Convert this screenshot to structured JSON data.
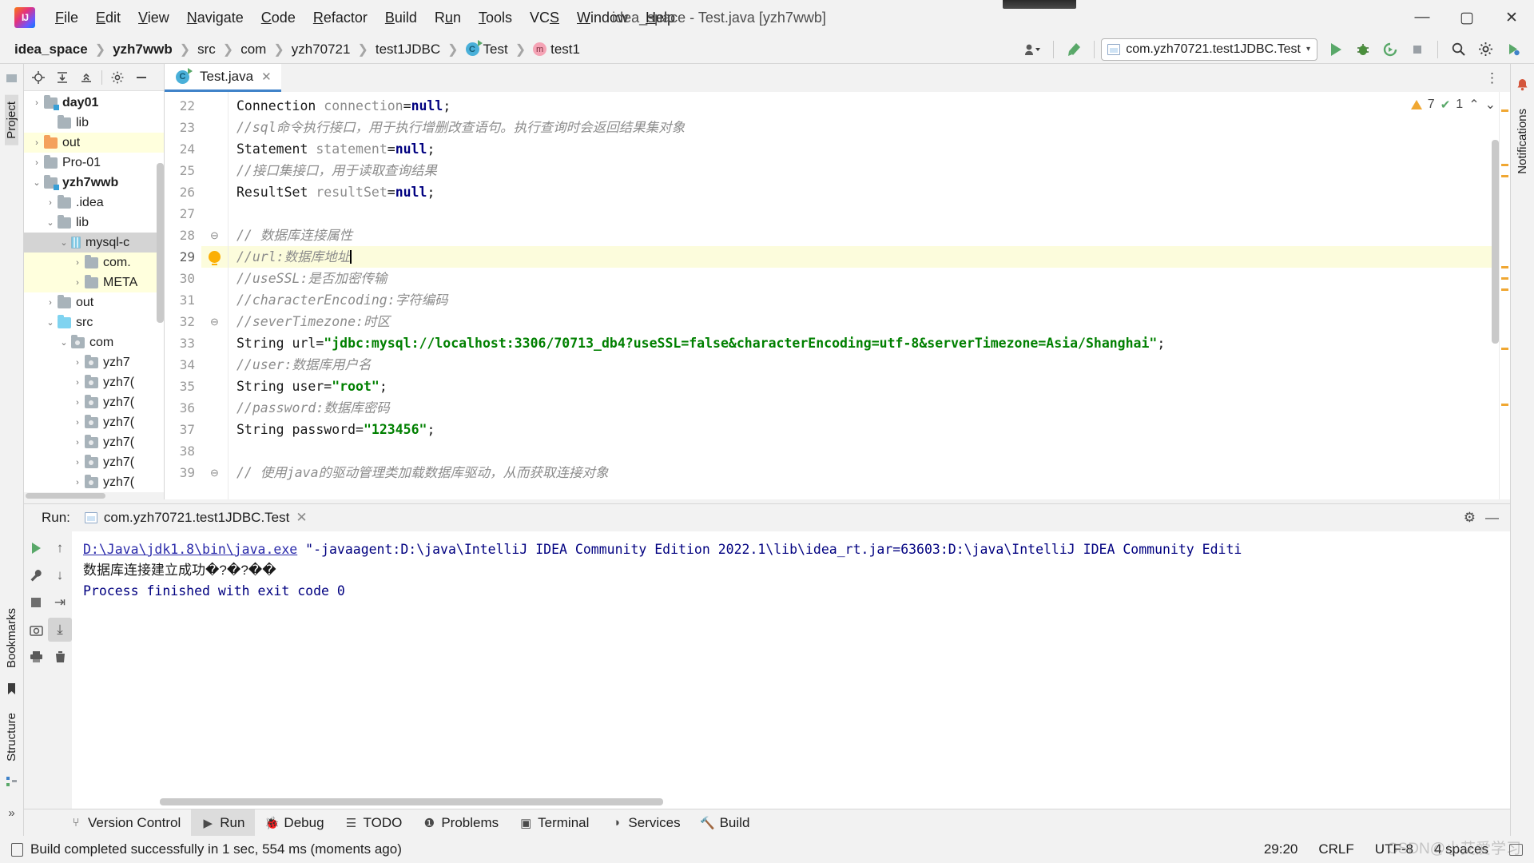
{
  "window": {
    "title": "idea_space - Test.java [yzh7wwb]",
    "logo_text": "IJ",
    "minimize": "—",
    "maximize": "▢",
    "close": "✕"
  },
  "menu": [
    {
      "pre": "",
      "mn": "F",
      "post": "ile"
    },
    {
      "pre": "",
      "mn": "E",
      "post": "dit"
    },
    {
      "pre": "",
      "mn": "V",
      "post": "iew"
    },
    {
      "pre": "",
      "mn": "N",
      "post": "avigate"
    },
    {
      "pre": "",
      "mn": "C",
      "post": "ode"
    },
    {
      "pre": "",
      "mn": "R",
      "post": "efactor"
    },
    {
      "pre": "",
      "mn": "B",
      "post": "uild"
    },
    {
      "pre": "R",
      "mn": "u",
      "post": "n"
    },
    {
      "pre": "",
      "mn": "T",
      "post": "ools"
    },
    {
      "pre": "VC",
      "mn": "S",
      "post": ""
    },
    {
      "pre": "",
      "mn": "W",
      "post": "indow"
    },
    {
      "pre": "",
      "mn": "H",
      "post": "elp"
    }
  ],
  "breadcrumbs": [
    {
      "label": "idea_space",
      "bold": true,
      "icon": ""
    },
    {
      "label": "yzh7wwb",
      "bold": true,
      "icon": ""
    },
    {
      "label": "src",
      "bold": false,
      "icon": ""
    },
    {
      "label": "com",
      "bold": false,
      "icon": ""
    },
    {
      "label": "yzh70721",
      "bold": false,
      "icon": ""
    },
    {
      "label": "test1JDBC",
      "bold": false,
      "icon": ""
    },
    {
      "label": "Test",
      "bold": false,
      "icon": "class-icon"
    },
    {
      "label": "test1",
      "bold": false,
      "icon": "method-icon"
    }
  ],
  "navbar": {
    "separator": "❯",
    "account_icon": "account-icon",
    "hammer_icon": "build-hammer-icon",
    "run_config": "com.yzh70721.test1JDBC.Test",
    "run_config_caret": "▾",
    "run_icon": "run-icon",
    "debug_icon": "debug-icon",
    "run_coverage_icon": "run-with-coverage-icon",
    "stop_icon": "stop-icon",
    "search_icon": "🔍",
    "settings_icon": "⚙",
    "updates_icon": "updates-icon"
  },
  "left_rail": {
    "project_label": "Project",
    "bookmarks_label": "Bookmarks",
    "structure_label": "Structure",
    "more_label": "»"
  },
  "right_rail": {
    "notifications_label": "Notifications"
  },
  "project_panel": {
    "toolbar": [
      "locate-icon",
      "expand-all-icon",
      "collapse-all-icon",
      "gear-icon",
      "hide-icon"
    ],
    "tree": [
      {
        "label": "day01",
        "indent": 1,
        "twisty": "›",
        "icon": "folder-module",
        "bold": true,
        "state": "none",
        "partial": true
      },
      {
        "label": "lib",
        "indent": 2,
        "twisty": "",
        "icon": "folder",
        "bold": false,
        "state": "none"
      },
      {
        "label": "out",
        "indent": 1,
        "twisty": "›",
        "icon": "folder-orange",
        "bold": false,
        "state": "yellow"
      },
      {
        "label": "Pro-01",
        "indent": 1,
        "twisty": "›",
        "icon": "folder",
        "bold": false,
        "state": "none"
      },
      {
        "label": "yzh7wwb",
        "indent": 1,
        "twisty": "⌄",
        "icon": "folder-module",
        "bold": true,
        "state": "none"
      },
      {
        "label": ".idea",
        "indent": 2,
        "twisty": "›",
        "icon": "folder",
        "bold": false,
        "state": "none"
      },
      {
        "label": "lib",
        "indent": 2,
        "twisty": "⌄",
        "icon": "folder",
        "bold": false,
        "state": "none"
      },
      {
        "label": "mysql-c",
        "indent": 3,
        "twisty": "⌄",
        "icon": "jar",
        "bold": false,
        "state": "grey"
      },
      {
        "label": "com.",
        "indent": 4,
        "twisty": "›",
        "icon": "folder",
        "bold": false,
        "state": "yellow"
      },
      {
        "label": "META",
        "indent": 4,
        "twisty": "›",
        "icon": "folder",
        "bold": false,
        "state": "yellow"
      },
      {
        "label": "out",
        "indent": 2,
        "twisty": "›",
        "icon": "folder",
        "bold": false,
        "state": "none"
      },
      {
        "label": "src",
        "indent": 2,
        "twisty": "⌄",
        "icon": "folder-blue",
        "bold": false,
        "state": "none"
      },
      {
        "label": "com",
        "indent": 3,
        "twisty": "⌄",
        "icon": "folder-pkg",
        "bold": false,
        "state": "none"
      },
      {
        "label": "yzh7",
        "indent": 4,
        "twisty": "›",
        "icon": "folder-pkg",
        "bold": false,
        "state": "none"
      },
      {
        "label": "yzh7(",
        "indent": 4,
        "twisty": "›",
        "icon": "folder-pkg",
        "bold": false,
        "state": "none"
      },
      {
        "label": "yzh7(",
        "indent": 4,
        "twisty": "›",
        "icon": "folder-pkg",
        "bold": false,
        "state": "none"
      },
      {
        "label": "yzh7(",
        "indent": 4,
        "twisty": "›",
        "icon": "folder-pkg",
        "bold": false,
        "state": "none"
      },
      {
        "label": "yzh7(",
        "indent": 4,
        "twisty": "›",
        "icon": "folder-pkg",
        "bold": false,
        "state": "none"
      },
      {
        "label": "yzh7(",
        "indent": 4,
        "twisty": "›",
        "icon": "folder-pkg",
        "bold": false,
        "state": "none"
      },
      {
        "label": "yzh7(",
        "indent": 4,
        "twisty": "›",
        "icon": "folder-pkg",
        "bold": false,
        "state": "none"
      }
    ]
  },
  "editor": {
    "tab": {
      "label": "Test.java",
      "icon": "java-class-icon",
      "close": "✕"
    },
    "tab_options_icon": "⋮",
    "inspection": {
      "warning_count": "7",
      "check_count": "1",
      "up": "⌃",
      "down": "⌄"
    },
    "first_line": 22,
    "lines": [
      {
        "n": 22,
        "marker": "",
        "segs": [
          {
            "t": "Connection ",
            "c": "type"
          },
          {
            "t": "connection",
            "c": "var"
          },
          {
            "t": "=",
            "c": "type"
          },
          {
            "t": "null",
            "c": "kw"
          },
          {
            "t": ";",
            "c": "type"
          }
        ]
      },
      {
        "n": 23,
        "marker": "",
        "segs": [
          {
            "t": "//sql命令执行接口，用于执行增删改查语句。执行查询时会返回结果集对象",
            "c": "cmt"
          }
        ]
      },
      {
        "n": 24,
        "marker": "",
        "segs": [
          {
            "t": "Statement ",
            "c": "type"
          },
          {
            "t": "statement",
            "c": "var"
          },
          {
            "t": "=",
            "c": "type"
          },
          {
            "t": "null",
            "c": "kw"
          },
          {
            "t": ";",
            "c": "type"
          }
        ]
      },
      {
        "n": 25,
        "marker": "",
        "segs": [
          {
            "t": "//接口集接口，用于读取查询结果",
            "c": "cmt"
          }
        ]
      },
      {
        "n": 26,
        "marker": "",
        "segs": [
          {
            "t": "ResultSet ",
            "c": "type"
          },
          {
            "t": "resultSet",
            "c": "var"
          },
          {
            "t": "=",
            "c": "type"
          },
          {
            "t": "null",
            "c": "kw"
          },
          {
            "t": ";",
            "c": "type"
          }
        ]
      },
      {
        "n": 27,
        "marker": "",
        "segs": []
      },
      {
        "n": 28,
        "marker": "fold",
        "segs": [
          {
            "t": "// 数据库连接属性",
            "c": "cmt"
          }
        ]
      },
      {
        "n": 29,
        "marker": "bulb",
        "highlight": true,
        "caret": true,
        "segs": [
          {
            "t": "//url:数据库地址",
            "c": "cmt"
          }
        ]
      },
      {
        "n": 30,
        "marker": "",
        "segs": [
          {
            "t": "//useSSL:是否加密传输",
            "c": "cmt"
          }
        ]
      },
      {
        "n": 31,
        "marker": "",
        "segs": [
          {
            "t": "//characterEncoding:字符编码",
            "c": "cmt"
          }
        ]
      },
      {
        "n": 32,
        "marker": "fold",
        "segs": [
          {
            "t": "//severTimezone:时区",
            "c": "cmt"
          }
        ]
      },
      {
        "n": 33,
        "marker": "",
        "segs": [
          {
            "t": "String ",
            "c": "type"
          },
          {
            "t": "url",
            "c": "type"
          },
          {
            "t": "=",
            "c": "type"
          },
          {
            "t": "\"jdbc:mysql://localhost:3306/70713_db4?useSSL=false&characterEncoding=utf-8&serverTimezone=Asia/Shanghai\"",
            "c": "str"
          },
          {
            "t": ";",
            "c": "type"
          }
        ]
      },
      {
        "n": 34,
        "marker": "",
        "segs": [
          {
            "t": "//user:数据库用户名",
            "c": "cmt"
          }
        ]
      },
      {
        "n": 35,
        "marker": "",
        "segs": [
          {
            "t": "String ",
            "c": "type"
          },
          {
            "t": "user",
            "c": "type"
          },
          {
            "t": "=",
            "c": "type"
          },
          {
            "t": "\"root\"",
            "c": "str"
          },
          {
            "t": ";",
            "c": "type"
          }
        ]
      },
      {
        "n": 36,
        "marker": "",
        "segs": [
          {
            "t": "//password:数据库密码",
            "c": "cmt"
          }
        ]
      },
      {
        "n": 37,
        "marker": "",
        "segs": [
          {
            "t": "String ",
            "c": "type"
          },
          {
            "t": "password",
            "c": "type"
          },
          {
            "t": "=",
            "c": "type"
          },
          {
            "t": "\"123456\"",
            "c": "str"
          },
          {
            "t": ";",
            "c": "type"
          }
        ]
      },
      {
        "n": 38,
        "marker": "",
        "segs": []
      },
      {
        "n": 39,
        "marker": "fold",
        "segs": [
          {
            "t": "// 使用java的驱动管理类加载数据库驱动，从而获取连接对象",
            "c": "cmt"
          }
        ]
      }
    ]
  },
  "run_window": {
    "label": "Run:",
    "tab": "com.yzh70721.test1JDBC.Test",
    "tab_close": "✕",
    "gear_icon": "⚙",
    "hide_icon": "—",
    "toolbar": [
      "rerun-icon",
      "wrench-icon",
      "stop-icon",
      "scroll-up-icon",
      "scroll-down-icon",
      "soft-wrap-icon",
      "scroll-to-end-icon",
      "print-icon",
      "clear-all-icon"
    ],
    "console": [
      {
        "type": "cmd",
        "link": "D:\\Java\\jdk1.8\\bin\\java.exe",
        "rest": " \"-javaagent:D:\\java\\IntelliJ IDEA Community Edition 2022.1\\lib\\idea_rt.jar=63603:D:\\java\\IntelliJ IDEA Community Editi"
      },
      {
        "type": "out",
        "text": "数据库连接建立成功�?�?��"
      },
      {
        "type": "blank",
        "text": ""
      },
      {
        "type": "exit",
        "text": "Process finished with exit code 0"
      }
    ]
  },
  "bottom_tools": [
    {
      "label": "Version Control",
      "icon": "branch-icon",
      "selected": false
    },
    {
      "label": "Run",
      "icon": "run-icon",
      "selected": true
    },
    {
      "label": "Debug",
      "icon": "debug-icon",
      "selected": false
    },
    {
      "label": "TODO",
      "icon": "todo-icon",
      "selected": false
    },
    {
      "label": "Problems",
      "icon": "problems-icon",
      "selected": false
    },
    {
      "label": "Terminal",
      "icon": "terminal-icon",
      "selected": false
    },
    {
      "label": "Services",
      "icon": "services-icon",
      "selected": false
    },
    {
      "label": "Build",
      "icon": "build-icon",
      "selected": false
    }
  ],
  "status_bar": {
    "message": "Build completed successfully in 1 sec, 554 ms (moments ago)",
    "caret_position": "29:20",
    "line_separator": "CRLF",
    "encoding": "UTF-8",
    "indent": "4 spaces",
    "lock_icon": "read-only-icon",
    "watermark": "CSDN@小艾爱学习"
  },
  "colors": {
    "accent_blue": "#4083c9",
    "string_green": "#008000",
    "keyword_navy": "#000080",
    "comment_grey": "#8c8c8c",
    "console_navy": "#000080",
    "highlight_yellow": "#fcfcdc",
    "warning_orange": "#f0a732",
    "check_green": "#59a869"
  }
}
